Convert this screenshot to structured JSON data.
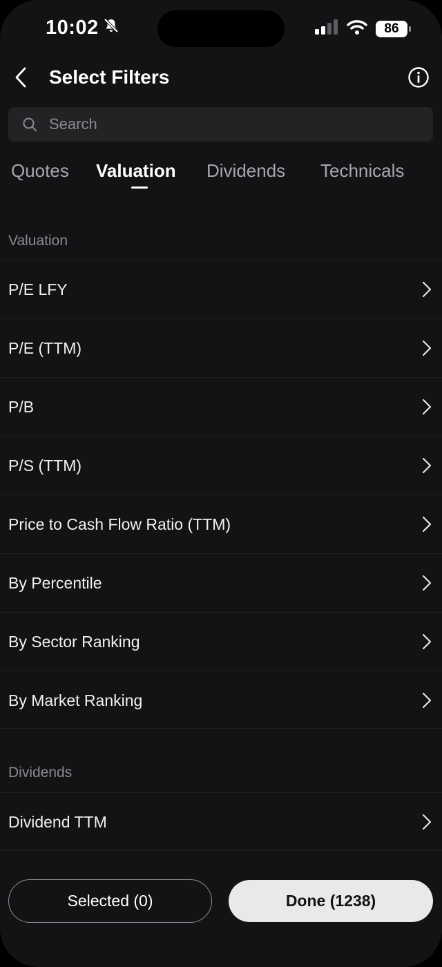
{
  "status_bar": {
    "time": "10:02",
    "battery": "86",
    "icons": [
      "bell-slash-icon",
      "cellular-signal-icon",
      "wifi-icon",
      "battery-icon"
    ]
  },
  "header": {
    "title": "Select Filters",
    "icons": [
      "back-chevron-icon",
      "info-icon"
    ]
  },
  "search": {
    "placeholder": "Search",
    "value": "",
    "icon": "search-icon"
  },
  "tabs": [
    {
      "label": "Quotes",
      "active": false
    },
    {
      "label": "Valuation",
      "active": true
    },
    {
      "label": "Dividends",
      "active": false
    },
    {
      "label": "Technicals",
      "active": false
    }
  ],
  "sections": [
    {
      "label": "Valuation",
      "items": [
        {
          "label": "P/E LFY"
        },
        {
          "label": "P/E (TTM)"
        },
        {
          "label": "P/B"
        },
        {
          "label": "P/S (TTM)"
        },
        {
          "label": "Price to Cash Flow Ratio (TTM)"
        },
        {
          "label": "By Percentile"
        },
        {
          "label": "By Sector Ranking"
        },
        {
          "label": "By Market Ranking"
        }
      ]
    },
    {
      "label": "Dividends",
      "items": [
        {
          "label": "Dividend TTM"
        }
      ]
    }
  ],
  "footer": {
    "selected_label": "Selected (0)",
    "done_label": "Done (1238)"
  },
  "colors": {
    "background": "#121314",
    "search_bg": "#222325",
    "done_bg": "#e9e9eb",
    "muted_text": "#8a8b8e"
  }
}
